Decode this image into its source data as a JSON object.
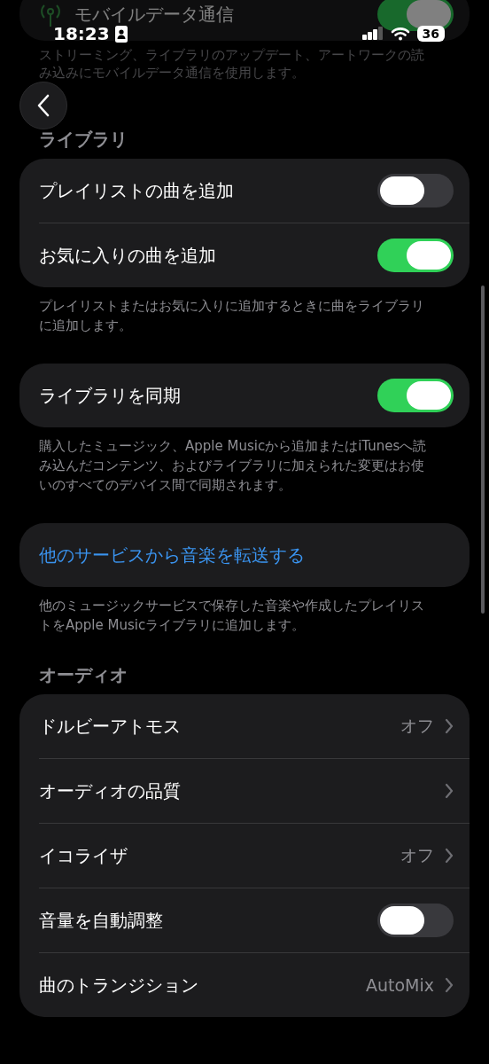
{
  "status_bar": {
    "time": "18:23",
    "battery": "36"
  },
  "cellular": {
    "label": "モバイルデータ通信",
    "on": true,
    "description": "ストリーミング、ライブラリのアップデート、アートワークの読み込みにモバイルデータ通信を使用します。"
  },
  "sections": [
    {
      "header": "ライブラリ",
      "rows": [
        {
          "kind": "toggle",
          "label": "プレイリストの曲を追加",
          "on": false
        },
        {
          "kind": "toggle",
          "label": "お気に入りの曲を追加",
          "on": true
        }
      ],
      "footer": "プレイリストまたはお気に入りに追加するときに曲をライブラリに追加します。"
    },
    {
      "rows": [
        {
          "kind": "toggle",
          "label": "ライブラリを同期",
          "on": true
        }
      ],
      "footer": "購入したミュージック、Apple Musicから追加またはiTunesへ読み込んだコンテンツ、およびライブラリに加えられた変更はお使いのすべてのデバイス間で同期されます。"
    },
    {
      "rows": [
        {
          "kind": "link",
          "label": "他のサービスから音楽を転送する"
        }
      ],
      "footer": "他のミュージックサービスで保存した音楽や作成したプレイリストをApple Musicライブラリに追加します。"
    },
    {
      "header": "オーディオ",
      "rows": [
        {
          "kind": "disclosure",
          "label": "ドルビーアトモス",
          "value": "オフ"
        },
        {
          "kind": "disclosure",
          "label": "オーディオの品質"
        },
        {
          "kind": "disclosure",
          "label": "イコライザ",
          "value": "オフ"
        },
        {
          "kind": "toggle",
          "label": "音量を自動調整",
          "on": false
        },
        {
          "kind": "disclosure",
          "label": "曲のトランジション",
          "value": "AutoMix"
        }
      ]
    }
  ]
}
